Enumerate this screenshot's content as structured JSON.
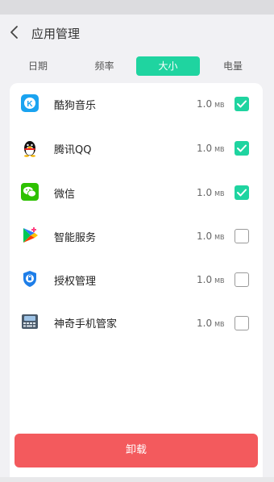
{
  "header": {
    "title": "应用管理"
  },
  "tabs": [
    {
      "label": "日期",
      "active": false
    },
    {
      "label": "频率",
      "active": false
    },
    {
      "label": "大小",
      "active": true
    },
    {
      "label": "电量",
      "active": false
    }
  ],
  "apps": [
    {
      "name": "酷狗音乐",
      "size_value": "1.0",
      "size_unit": "MB",
      "checked": true,
      "icon": "kugou-icon"
    },
    {
      "name": "腾讯QQ",
      "size_value": "1.0",
      "size_unit": "MB",
      "checked": true,
      "icon": "qq-penguin-icon"
    },
    {
      "name": "微信",
      "size_value": "1.0",
      "size_unit": "MB",
      "checked": true,
      "icon": "wechat-icon"
    },
    {
      "name": "智能服务",
      "size_value": "1.0",
      "size_unit": "MB",
      "checked": false,
      "icon": "smart-service-icon"
    },
    {
      "name": "授权管理",
      "size_value": "1.0",
      "size_unit": "MB",
      "checked": false,
      "icon": "shield-lock-icon"
    },
    {
      "name": "神奇手机管家",
      "size_value": "1.0",
      "size_unit": "MB",
      "checked": false,
      "icon": "phone-manager-icon"
    }
  ],
  "actions": {
    "uninstall_label": "卸载"
  },
  "colors": {
    "accent": "#1fd4a0",
    "danger": "#f35a5d"
  }
}
